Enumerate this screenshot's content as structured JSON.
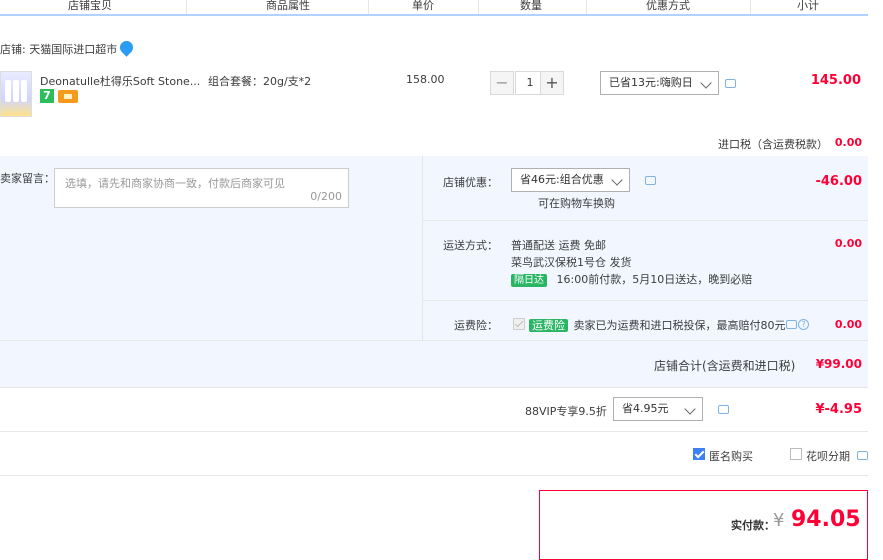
{
  "header": {
    "col_shop_item": "店铺宝贝",
    "col_attrs": "商品属性",
    "col_price": "单价",
    "col_qty": "数量",
    "col_discount": "优惠方式",
    "col_subtotal": "小计"
  },
  "shop": {
    "label": "店铺: 天猫国际进口超市"
  },
  "item": {
    "title": "Deonatulle杜得乐Soft Stone...",
    "badge_7": "7",
    "sku": "组合套餐：20g/支*2",
    "unit_price": "158.00",
    "quantity": "1",
    "minus": "−",
    "plus": "+",
    "discount_select": "已省13元:嗨购日",
    "subtotal": "145.00"
  },
  "import_tax": {
    "label": "进口税（含运费税款）",
    "value": "0.00"
  },
  "buyer_message": {
    "label": "卖家留言：",
    "placeholder": "选填，请先和商家协商一致，付款后商家可见",
    "counter": "0/200"
  },
  "shop_discount": {
    "label": "店铺优惠：",
    "select": "省46元:组合优惠",
    "note": "可在购物车换购",
    "value": "-46.00"
  },
  "shipping": {
    "label": "运送方式：",
    "method": "普通配送 运费 免邮",
    "warehouse": "菜鸟武汉保税1号仓  发货",
    "tag": "隔日达",
    "promise": "16:00前付款，5月10日送达，晚到必赔",
    "value": "0.00"
  },
  "insurance": {
    "label": "运费险：",
    "tag": "运费险",
    "desc": "卖家已为运费和进口税投保，最高赔付80元",
    "value": "0.00"
  },
  "shop_total": {
    "label": "店铺合计(含运费和进口税)",
    "value": "¥99.00"
  },
  "vip": {
    "label": "88VIP专享9.5折",
    "select": "省4.95元",
    "value": "¥-4.95"
  },
  "options": {
    "anonymous": "匿名购买",
    "installment": "花呗分期"
  },
  "payment": {
    "label": "实付款：",
    "currency": "¥",
    "amount": "94.05"
  },
  "colors": {
    "accent_red": "#ff0036",
    "panel_blue": "#f2f7ff",
    "header_line": "#b2d1ff",
    "tag_green": "#29b564"
  }
}
